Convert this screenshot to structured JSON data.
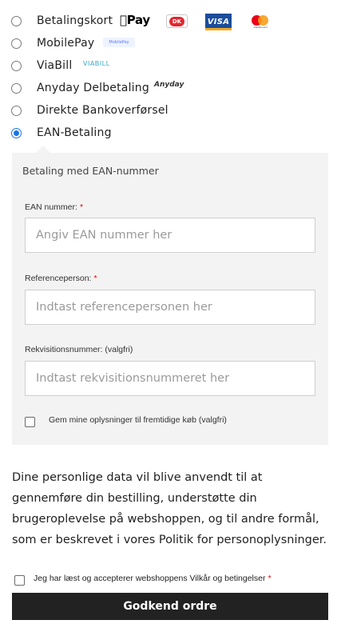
{
  "payment_methods": [
    {
      "label": "Betalingskort",
      "selected": false,
      "logos": [
        "apple-pay",
        "dankort",
        "visa",
        "mastercard"
      ]
    },
    {
      "label": "MobilePay",
      "selected": false,
      "logos": [
        "mobilepay"
      ]
    },
    {
      "label": "ViaBill",
      "selected": false,
      "logos": [
        "viabill"
      ]
    },
    {
      "label": "Anyday Delbetaling",
      "selected": false,
      "logos": [
        "anyday"
      ]
    },
    {
      "label": "Direkte Bankoverførsel",
      "selected": false,
      "logos": []
    },
    {
      "label": "EAN-Betaling",
      "selected": true,
      "logos": []
    }
  ],
  "logos": {
    "apple_pay": "Pay",
    "dankort": "DK",
    "visa": "VISA",
    "mastercard": "mastercard",
    "mobilepay": "MobilePay",
    "viabill": "VIABILL",
    "anyday": "Anyday"
  },
  "ean_panel": {
    "title": "Betaling med EAN-nummer",
    "fields": [
      {
        "label": "EAN nummer:",
        "required_mark": "*",
        "placeholder": "Angiv EAN nummer her",
        "value": ""
      },
      {
        "label": "Referenceperson:",
        "required_mark": "*",
        "placeholder": "Indtast referencepersonen her",
        "value": ""
      },
      {
        "label": "Rekvisitionsnummer: (valgfri)",
        "required_mark": "",
        "placeholder": "Indtast rekvisitionsnummeret her",
        "value": ""
      }
    ],
    "save_info_label": "Gem mine oplysninger til fremtidige køb (valgfri)"
  },
  "privacy_text": "Dine personlige data vil blive anvendt til at gennemføre din bestilling, understøtte din brugeroplevelse på webshoppen, og til andre formål, som er beskrevet i vores Politik for personoplysninger.",
  "terms": {
    "label": "Jeg har læst og accepterer webshoppens Vilkår og betingelser",
    "required_mark": "*"
  },
  "submit_label": "Godkend ordre",
  "colors": {
    "panel_bg": "#f3f3f3",
    "required": "#e00000",
    "button_bg": "#222222",
    "radio_selected": "#1a73e8"
  }
}
